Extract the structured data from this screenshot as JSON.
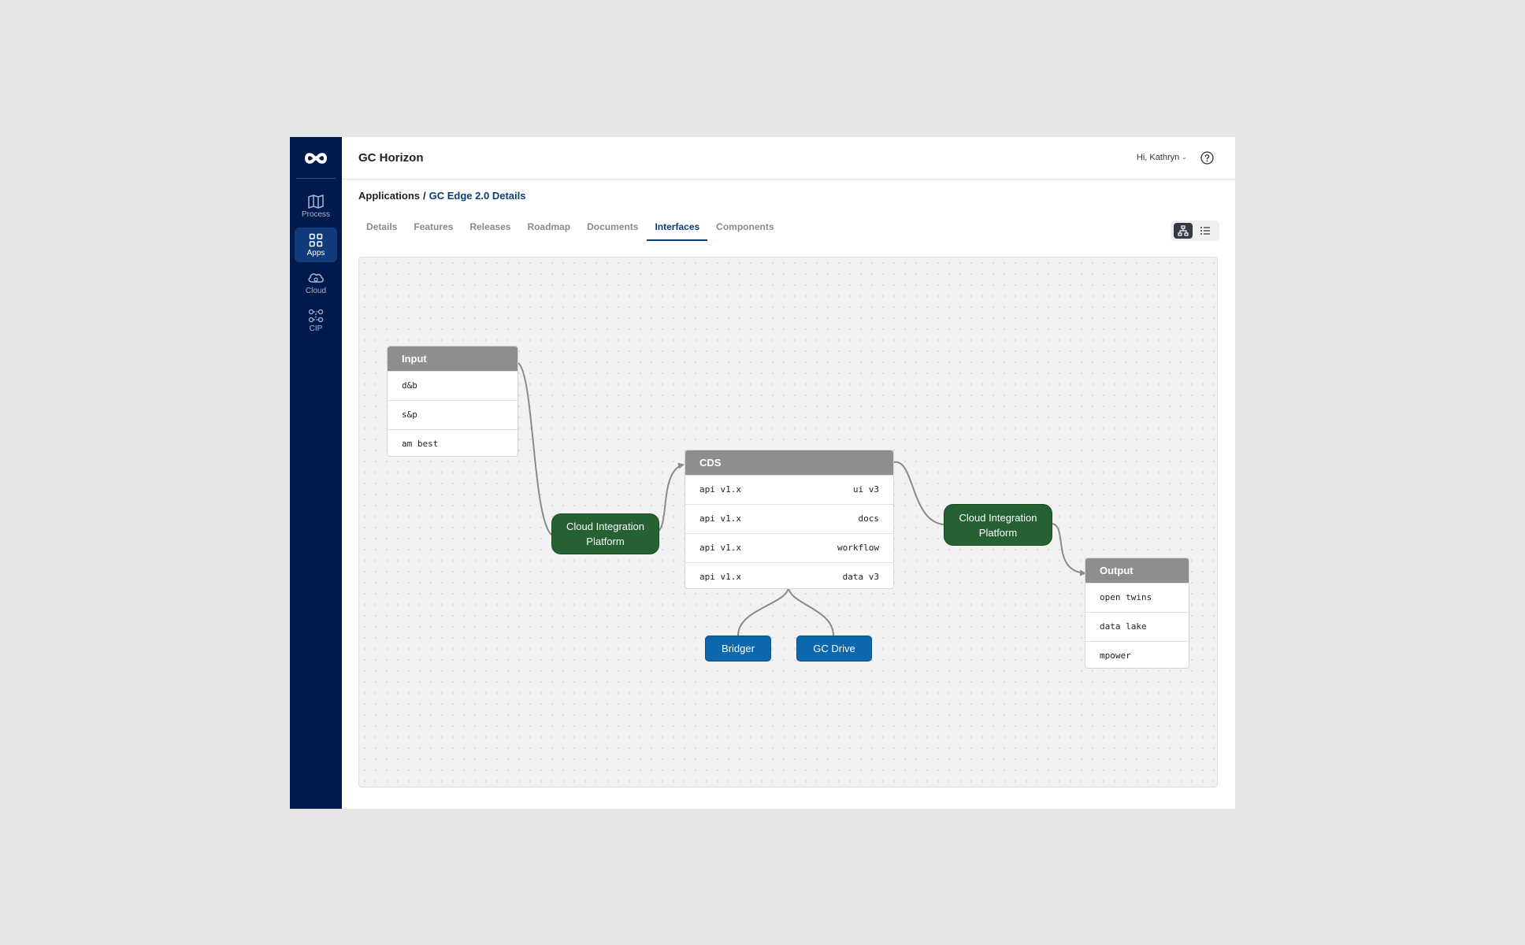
{
  "app": {
    "title": "GC Horizon",
    "user_greeting": "Hi, Kathryn"
  },
  "sidebar": {
    "items": [
      {
        "label": "Process",
        "icon": "map-icon",
        "active": false
      },
      {
        "label": "Apps",
        "icon": "grid-icon",
        "active": true
      },
      {
        "label": "Cloud",
        "icon": "cloud-icon",
        "active": false
      },
      {
        "label": "CIP",
        "icon": "integration-icon",
        "active": false
      }
    ]
  },
  "breadcrumb": {
    "parent": "Applications",
    "separator": "/",
    "current": "GC Edge 2.0 Details"
  },
  "tabs": [
    {
      "label": "Details",
      "active": false
    },
    {
      "label": "Features",
      "active": false
    },
    {
      "label": "Releases",
      "active": false
    },
    {
      "label": "Roadmap",
      "active": false
    },
    {
      "label": "Documents",
      "active": false
    },
    {
      "label": "Interfaces",
      "active": true
    },
    {
      "label": "Components",
      "active": false
    }
  ],
  "view_toggle": {
    "selected": "graph",
    "options": [
      "graph-view-icon",
      "list-view-icon"
    ]
  },
  "diagram": {
    "input": {
      "title": "Input",
      "rows": [
        "d&b",
        "s&p",
        "am best"
      ]
    },
    "cip_left": {
      "label": "Cloud Integration Platform"
    },
    "cds": {
      "title": "CDS",
      "rows": [
        {
          "left": "api v1.x",
          "right": "ui v3"
        },
        {
          "left": "api v1.x",
          "right": "docs"
        },
        {
          "left": "api v1.x",
          "right": "workflow"
        },
        {
          "left": "api v1.x",
          "right": "data v3"
        }
      ]
    },
    "cip_right": {
      "label": "Cloud Integration Platform"
    },
    "output": {
      "title": "Output",
      "rows": [
        "open twins",
        "data lake",
        "mpower"
      ]
    },
    "bridger": {
      "label": "Bridger"
    },
    "gc_drive": {
      "label": "GC Drive"
    }
  },
  "colors": {
    "sidebar": "#001a4d",
    "accent": "#0f3c78",
    "platform_node": "#256132",
    "service_node": "#0c67ad",
    "card_header": "#8e8e8e"
  }
}
